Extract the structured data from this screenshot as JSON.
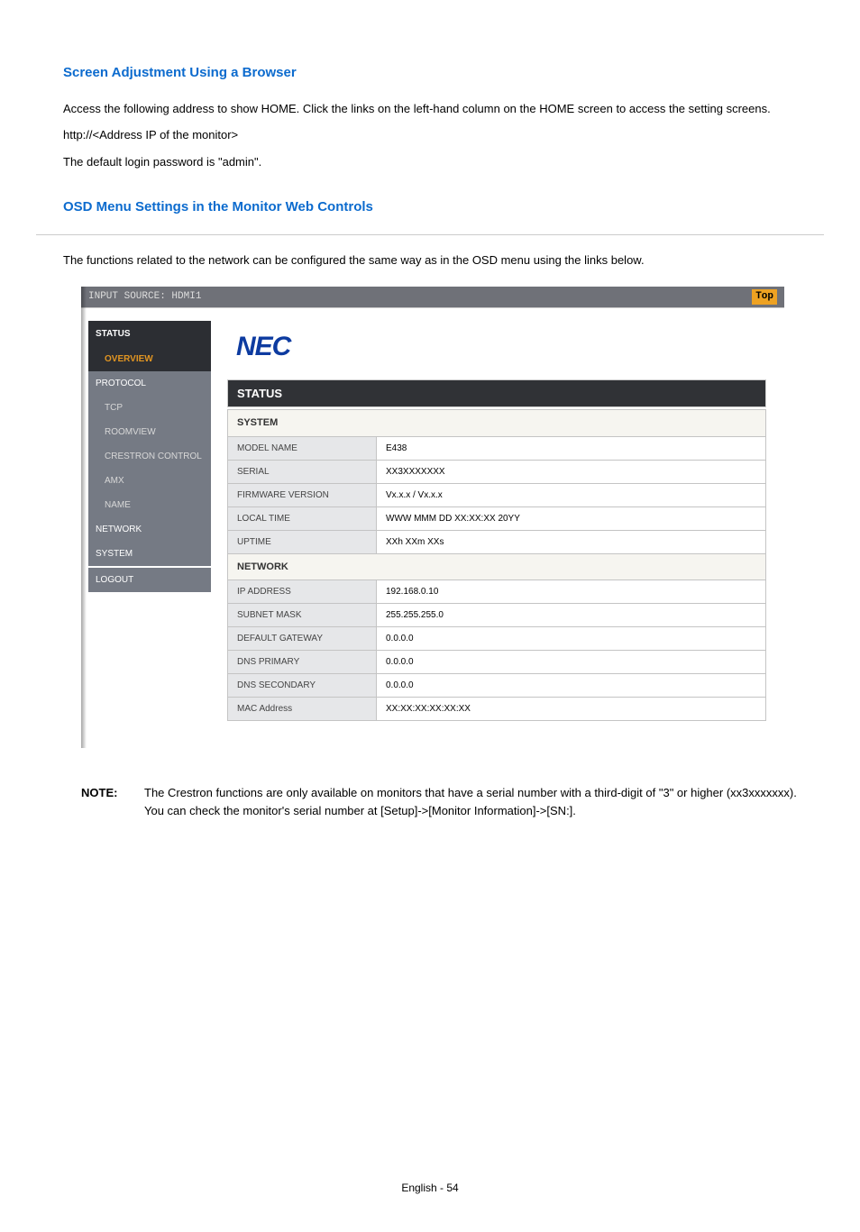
{
  "section1": {
    "title": "Screen Adjustment Using a Browser",
    "p1": "Access the following address to show HOME. Click the links on the left-hand column on the HOME screen to access the setting screens.",
    "p2": "http://<Address IP of the monitor>",
    "p3": "The default login password is \"admin\"."
  },
  "section2": {
    "title": "OSD Menu Settings in the Monitor Web Controls",
    "intro": "The functions related to the network can be configured the same way as in the OSD menu using the links below."
  },
  "ui": {
    "topbar_left": "INPUT SOURCE: HDMI1",
    "topbar_right": "Top",
    "logo": "NEC",
    "status_header": "STATUS"
  },
  "sidebar": {
    "status": "STATUS",
    "overview": "OVERVIEW",
    "protocol": "PROTOCOL",
    "tcp": "TCP",
    "roomview": "ROOMVIEW",
    "crestron": "CRESTRON CONTROL",
    "amx": "AMX",
    "name": "NAME",
    "network": "NETWORK",
    "system": "SYSTEM",
    "logout": "LOGOUT"
  },
  "tables": {
    "system_header": "SYSTEM",
    "network_header": "NETWORK",
    "system": [
      {
        "label": "MODEL NAME",
        "value": "E438"
      },
      {
        "label": "SERIAL",
        "value": "XX3XXXXXXX"
      },
      {
        "label": "FIRMWARE VERSION",
        "value": "Vx.x.x / Vx.x.x"
      },
      {
        "label": "LOCAL TIME",
        "value": "WWW MMM DD XX:XX:XX 20YY"
      },
      {
        "label": "UPTIME",
        "value": "XXh XXm XXs"
      }
    ],
    "network": [
      {
        "label": "IP ADDRESS",
        "value": "192.168.0.10"
      },
      {
        "label": "SUBNET MASK",
        "value": "255.255.255.0"
      },
      {
        "label": "DEFAULT GATEWAY",
        "value": "0.0.0.0"
      },
      {
        "label": "DNS PRIMARY",
        "value": "0.0.0.0"
      },
      {
        "label": "DNS SECONDARY",
        "value": "0.0.0.0"
      },
      {
        "label": "MAC Address",
        "value": "XX:XX:XX:XX:XX:XX"
      }
    ]
  },
  "note": {
    "label": "NOTE:",
    "line1": "The Crestron functions are only available on monitors that have a serial number with a third-digit of \"3\" or higher (xx3xxxxxxx).",
    "line2": "You can check the monitor's serial number at [Setup]->[Monitor Information]->[SN:]."
  },
  "footer": "English - 54"
}
